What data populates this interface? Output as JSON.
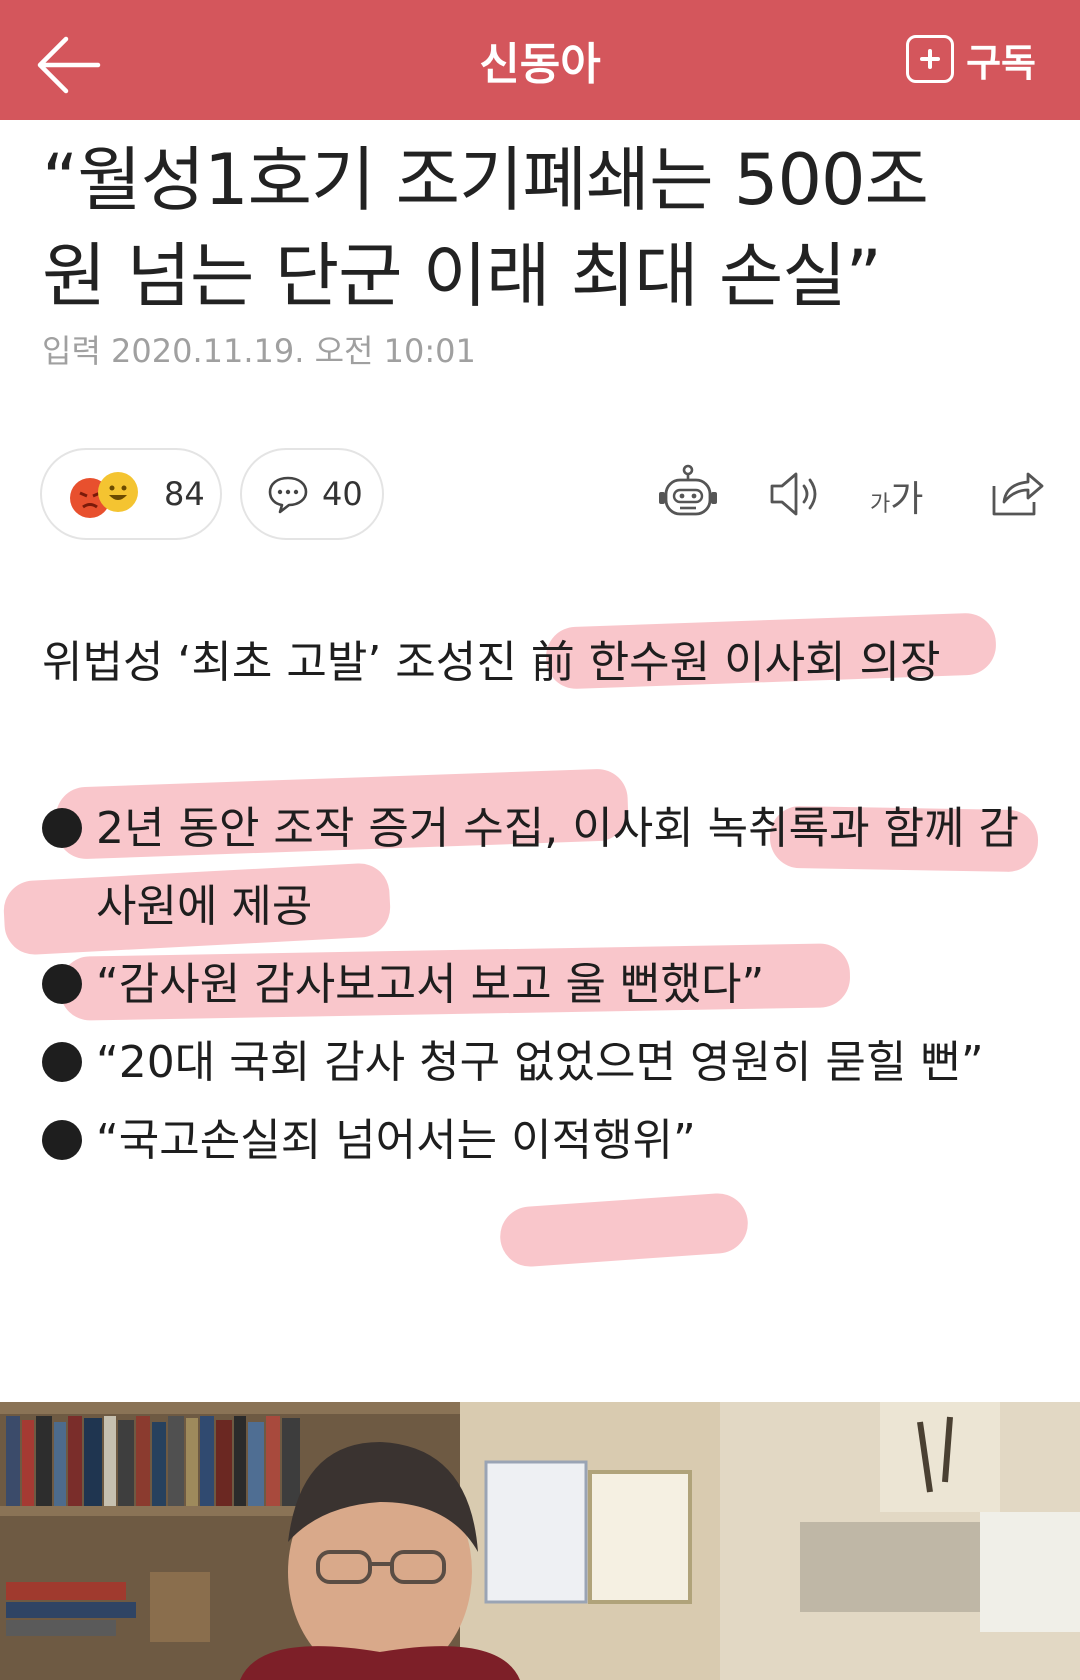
{
  "header": {
    "brand": "신동아",
    "subscribe_label": "구독",
    "bg_color": "#d4565c"
  },
  "article": {
    "headline_line1": "“월성1호기 조기폐쇄는 500조",
    "headline_line2": "원 넘는 단군 이래 최대 손실”",
    "dateline": "입력 2020.11.19. 오전 10:01"
  },
  "actions": {
    "reaction_count": "84",
    "comment_count": "40",
    "font_size_small": "가",
    "font_size_big": "가",
    "icons": [
      "angry-emoji-icon",
      "laugh-emoji-icon",
      "comment-icon",
      "robot-icon",
      "speaker-icon",
      "font-size-icon",
      "share-icon"
    ]
  },
  "summary": {
    "subtitle": "위법성 ‘최초 고발’ 조성진 前 한수원 이사회 의장",
    "bullets": [
      "2년 동안 조작 증거 수집, 이사회 녹취록과 함께 감사원에 제공",
      "“감사원 감사보고서 보고 울 뻔했다”",
      "“20대 국회 감사 청구 없었으면 영원히 묻힐 뻔”",
      "“국고손실죄 넘어서는 이적행위”"
    ],
    "highlight_color": "#f07882"
  }
}
